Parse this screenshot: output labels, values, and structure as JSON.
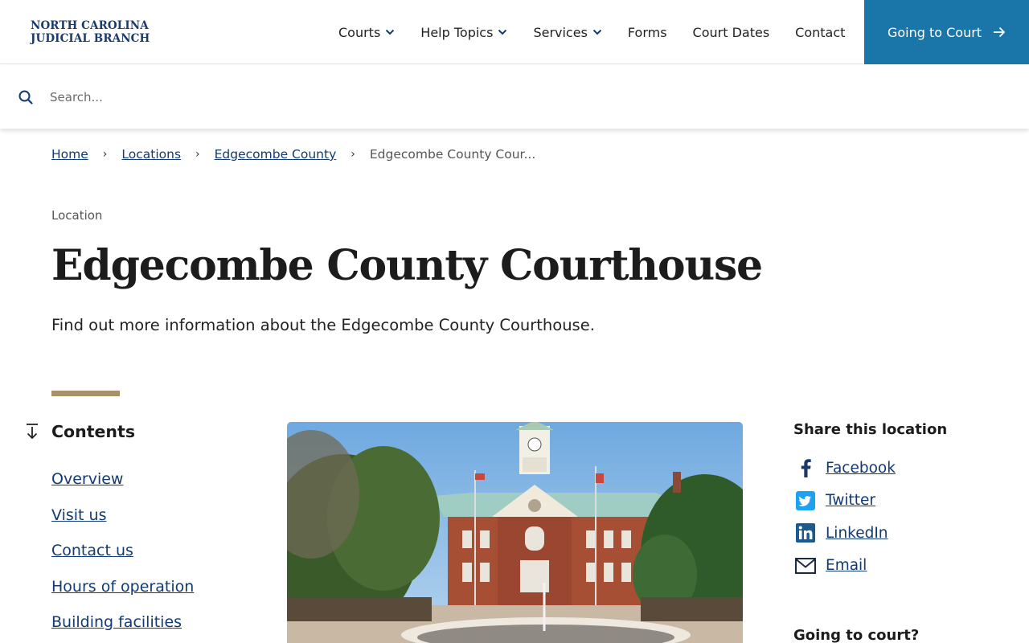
{
  "header": {
    "logo_line1": "NORTH CAROLINA",
    "logo_line2": "JUDICIAL BRANCH",
    "nav": [
      {
        "label": "Courts"
      },
      {
        "label": "Help Topics"
      },
      {
        "label": "Services"
      },
      {
        "label": "Forms"
      },
      {
        "label": "Court Dates"
      },
      {
        "label": "Contact"
      }
    ],
    "cta_label": "Going to Court"
  },
  "search": {
    "placeholder": "Search...",
    "value": ""
  },
  "breadcrumb": {
    "items": [
      "Home",
      "Locations",
      "Edgecombe County"
    ],
    "current": "Edgecombe County Cour..."
  },
  "page": {
    "eyebrow": "Location",
    "title": "Edgecombe County Courthouse",
    "subtitle": "Find out more information about the Edgecombe County Courthouse."
  },
  "contents": {
    "heading": "Contents",
    "items": [
      "Overview",
      "Visit us",
      "Contact us",
      "Hours of operation",
      "Building facilities"
    ]
  },
  "share": {
    "heading": "Share this location",
    "items": [
      {
        "label": "Facebook",
        "icon": "facebook-icon"
      },
      {
        "label": "Twitter",
        "icon": "twitter-icon"
      },
      {
        "label": "LinkedIn",
        "icon": "linkedin-icon"
      },
      {
        "label": "Email",
        "icon": "email-icon"
      }
    ],
    "next_heading": "Going to court?"
  },
  "colors": {
    "brand_navy": "#1b3a6b",
    "cta_blue": "#1a75a8",
    "link": "#123a74",
    "accent_tan": "#a89169"
  }
}
